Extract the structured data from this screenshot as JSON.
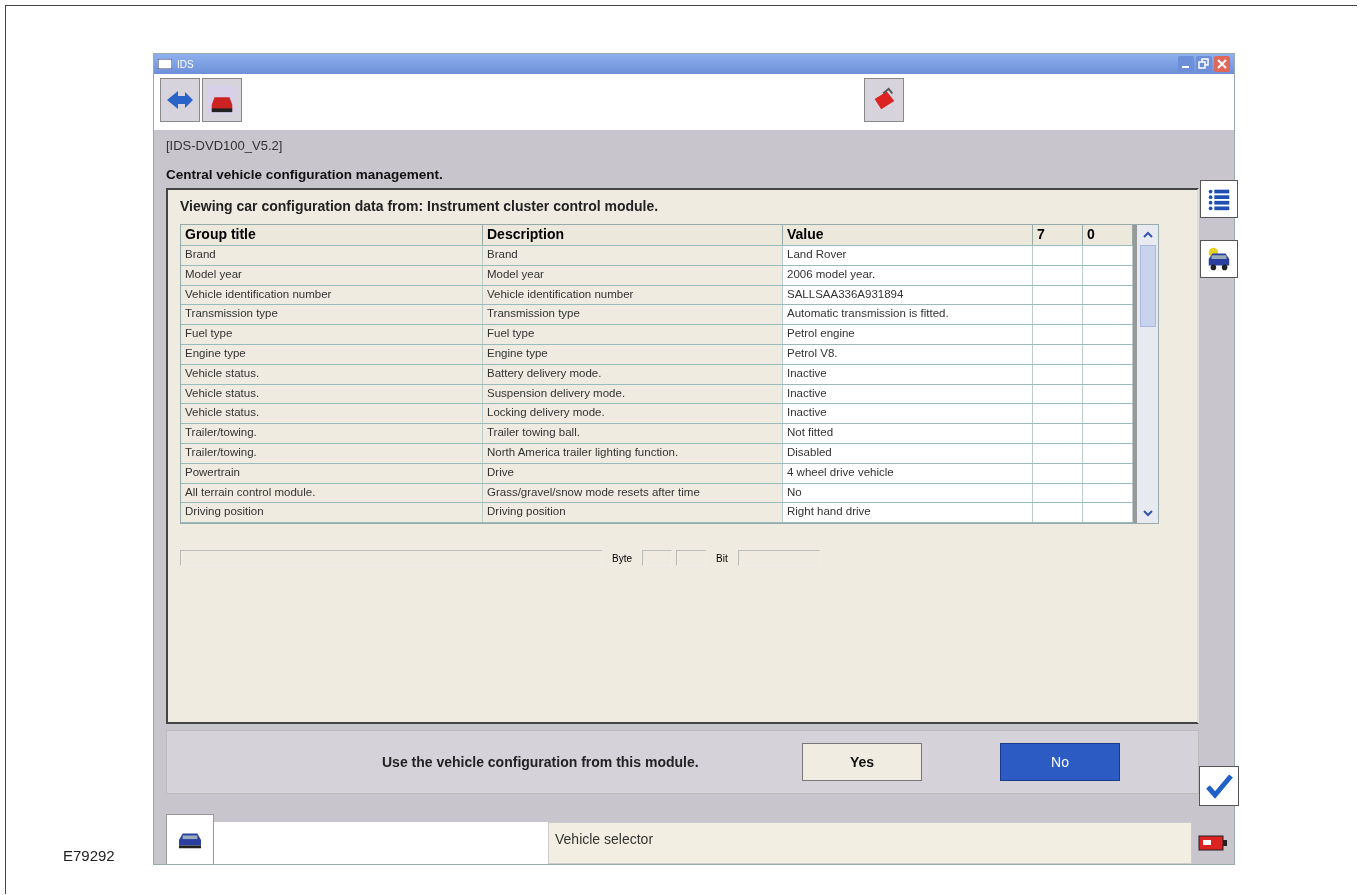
{
  "window": {
    "title": "IDS"
  },
  "version": "[IDS-DVD100_V5.2]",
  "heading": "Central vehicle configuration management.",
  "panel": {
    "title": "Viewing car configuration data from: Instrument cluster control module.",
    "table": {
      "columns": [
        "Group title",
        "Description",
        "Value",
        "7",
        "0"
      ],
      "rows": [
        [
          "Brand",
          "Brand",
          "Land Rover",
          "",
          ""
        ],
        [
          "Model year",
          "Model year",
          "2006 model year.",
          "",
          ""
        ],
        [
          "Vehicle identification number",
          "Vehicle identification number",
          "SALLSAA336A931894",
          "",
          ""
        ],
        [
          "Transmission type",
          "Transmission type",
          "Automatic transmission is fitted.",
          "",
          ""
        ],
        [
          "Fuel type",
          "Fuel type",
          "Petrol engine",
          "",
          ""
        ],
        [
          "Engine type",
          "Engine type",
          "Petrol V8.",
          "",
          ""
        ],
        [
          "Vehicle status.",
          "Battery delivery mode.",
          "Inactive",
          "",
          ""
        ],
        [
          "Vehicle status.",
          "Suspension delivery mode.",
          "Inactive",
          "",
          ""
        ],
        [
          "Vehicle status.",
          "Locking delivery mode.",
          "Inactive",
          "",
          ""
        ],
        [
          "Trailer/towing.",
          "Trailer towing ball.",
          "Not fitted",
          "",
          ""
        ],
        [
          "Trailer/towing.",
          "North America trailer lighting function.",
          "Disabled",
          "",
          ""
        ],
        [
          "Powertrain",
          "Drive",
          "4 wheel drive vehicle",
          "",
          ""
        ],
        [
          "All terrain control module.",
          "Grass/gravel/snow mode resets after time",
          "No",
          "",
          ""
        ],
        [
          "Driving position",
          "Driving position",
          "Right hand drive",
          "",
          ""
        ]
      ]
    },
    "byte_label": "Byte",
    "bit_label": "Bit"
  },
  "prompt": {
    "text": "Use the vehicle configuration from this module.",
    "buttons": [
      {
        "label": "Yes",
        "selected": false
      },
      {
        "label": "No",
        "selected": true
      }
    ]
  },
  "status_bar": {
    "text": "Vehicle selector"
  },
  "figure_label": "E79292"
}
